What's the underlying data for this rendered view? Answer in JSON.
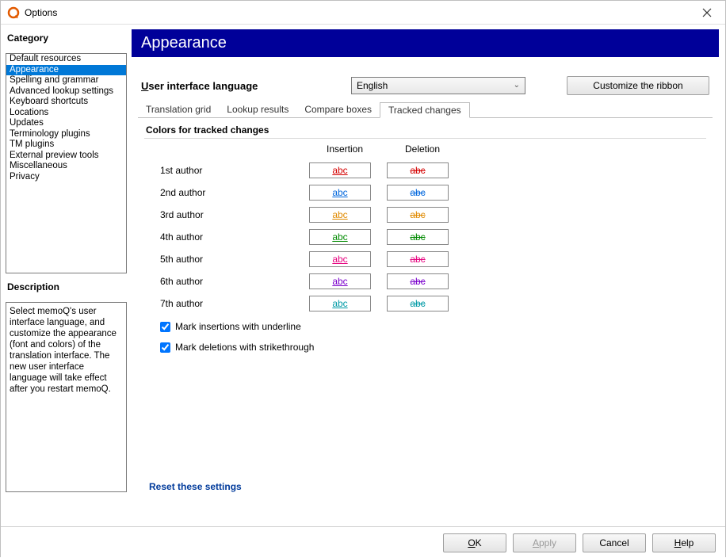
{
  "window": {
    "title": "Options"
  },
  "sidebar": {
    "heading": "Category",
    "items": [
      {
        "label": "Default resources"
      },
      {
        "label": "Appearance",
        "selected": true
      },
      {
        "label": "Spelling and grammar"
      },
      {
        "label": "Advanced lookup settings"
      },
      {
        "label": "Keyboard shortcuts"
      },
      {
        "label": "Locations"
      },
      {
        "label": "Updates"
      },
      {
        "label": "Terminology plugins"
      },
      {
        "label": "TM plugins"
      },
      {
        "label": "External preview tools"
      },
      {
        "label": "Miscellaneous"
      },
      {
        "label": "Privacy"
      }
    ],
    "description_heading": "Description",
    "description": "Select memoQ's user interface language, and customize the appearance (font and colors) of the translation interface. The new user interface language will take effect after you restart memoQ."
  },
  "main": {
    "banner": "Appearance",
    "ui_lang_label": "User interface language",
    "ui_lang_value": "English",
    "ribbon_button": "Customize the ribbon",
    "tabs": [
      {
        "label": "Translation grid"
      },
      {
        "label": "Lookup results"
      },
      {
        "label": "Compare boxes"
      },
      {
        "label": "Tracked changes",
        "active": true
      }
    ],
    "tracked": {
      "section_title": "Colors for tracked changes",
      "col_insertion": "Insertion",
      "col_deletion": "Deletion",
      "sample": "abc",
      "rows": [
        {
          "label": "1st author",
          "color": "#d40000"
        },
        {
          "label": "2nd author",
          "color": "#0066dd"
        },
        {
          "label": "3rd author",
          "color": "#e08a00"
        },
        {
          "label": "4th author",
          "color": "#008a00"
        },
        {
          "label": "5th author",
          "color": "#e6007e"
        },
        {
          "label": "6th author",
          "color": "#7a00cc"
        },
        {
          "label": "7th author",
          "color": "#009aa6"
        }
      ],
      "mark_ins": "Mark insertions with underline",
      "mark_del": "Mark deletions with strikethrough",
      "reset": "Reset these settings"
    }
  },
  "footer": {
    "ok": "OK",
    "apply": "Apply",
    "cancel": "Cancel",
    "help": "Help"
  }
}
